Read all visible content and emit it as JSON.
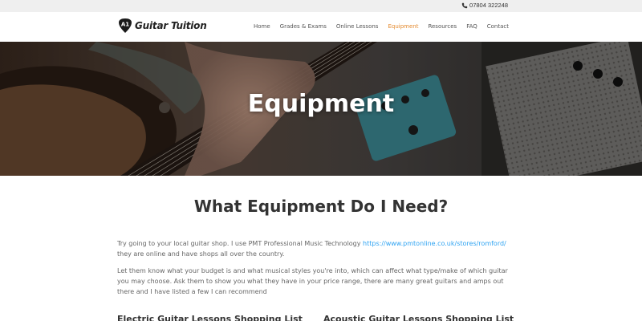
{
  "topbar": {
    "phone_icon": "phone-icon",
    "phone": "07804 322248"
  },
  "header": {
    "logo_mark": "A1",
    "logo_text": "Guitar Tuition",
    "nav": [
      {
        "label": "Home",
        "active": false
      },
      {
        "label": "Grades & Exams",
        "active": false
      },
      {
        "label": "Online Lessons",
        "active": false
      },
      {
        "label": "Equipment",
        "active": true
      },
      {
        "label": "Resources",
        "active": false
      },
      {
        "label": "FAQ",
        "active": false
      },
      {
        "label": "Contact",
        "active": false
      }
    ],
    "active_color": "#e48a2e"
  },
  "hero": {
    "title": "Equipment"
  },
  "main": {
    "heading": "What Equipment Do I Need?",
    "para1_before": "Try going to your local guitar shop. I use PMT Professional Music Technology ",
    "para1_link": "https://www.pmtonline.co.uk/stores/romford/",
    "para1_after": " they are online and have shops all over the country.",
    "para2": "Let them know what your budget is and what musical styles you're into, which can affect what type/make of which guitar you may choose. Ask them to show you what they have in your price range, there are many great guitars and amps out there and I have listed a few I can recommend",
    "col1_heading": "Electric Guitar Lessons Shopping List",
    "col2_heading": "Acoustic Guitar Lessons Shopping List",
    "link_color": "#2ea3f2"
  }
}
